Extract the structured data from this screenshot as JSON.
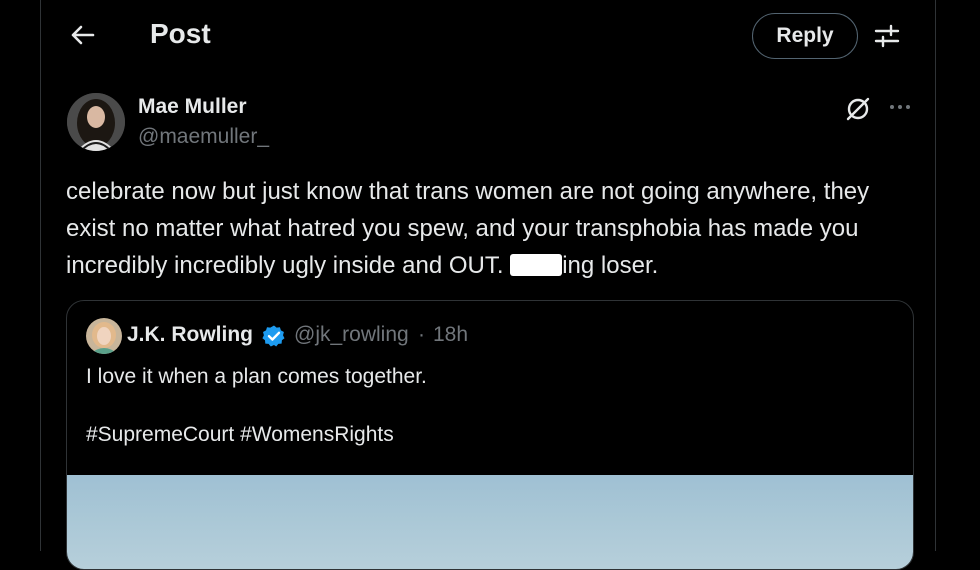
{
  "header": {
    "title": "Post",
    "reply_label": "Reply"
  },
  "post": {
    "author_name": "Mae Muller",
    "author_handle": "@maemuller_",
    "text_part1": "celebrate now but just know that trans women are not going anywhere, they exist no matter what hatred you spew, and your transphobia has made you incredibly incredibly ugly inside and OUT. ",
    "text_part2": "ing loser."
  },
  "quoted_post": {
    "author_name": "J.K. Rowling",
    "author_handle": "@jk_rowling",
    "separator": "·",
    "time": "18h",
    "text": "I love it when a plan comes together.",
    "hashtags": "#SupremeCourt #WomensRights"
  },
  "icons": {
    "back": "arrow-left-icon",
    "settings": "sliders-icon",
    "grok": "grok-icon",
    "more": "more-horizontal-icon",
    "verified": "verified-badge-icon"
  },
  "colors": {
    "background": "#000000",
    "text": "#e7e9ea",
    "secondary_text": "#71767b",
    "border": "#2f3336",
    "verified": "#1d9bf0"
  }
}
